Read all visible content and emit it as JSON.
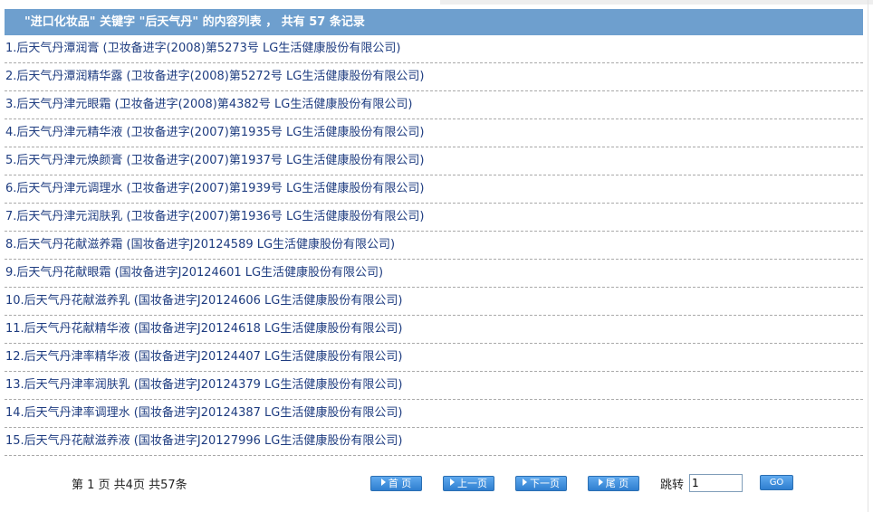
{
  "header": {
    "prefix": "\"进口化妆品\" 关键字 \"后天气丹\" 的内容列表 ， 共有 ",
    "count": "57",
    "suffix": " 条记录"
  },
  "items": [
    "1.后天气丹潭润膏 (卫妆备进字(2008)第5273号 LG生活健康股份有限公司)",
    "2.后天气丹潭润精华露 (卫妆备进字(2008)第5272号 LG生活健康股份有限公司)",
    "3.后天气丹津元眼霜 (卫妆备进字(2008)第4382号 LG生活健康股份有限公司)",
    "4.后天气丹津元精华液 (卫妆备进字(2007)第1935号 LG生活健康股份有限公司)",
    "5.后天气丹津元焕颜膏 (卫妆备进字(2007)第1937号 LG生活健康股份有限公司)",
    "6.后天气丹津元调理水 (卫妆备进字(2007)第1939号 LG生活健康股份有限公司)",
    "7.后天气丹津元润肤乳 (卫妆备进字(2007)第1936号 LG生活健康股份有限公司)",
    "8.后天气丹花献滋养霜 (国妆备进字J20124589 LG生活健康股份有限公司)",
    "9.后天气丹花献眼霜 (国妆备进字J20124601 LG生活健康股份有限公司)",
    "10.后天气丹花献滋养乳 (国妆备进字J20124606 LG生活健康股份有限公司)",
    "11.后天气丹花献精华液 (国妆备进字J20124618 LG生活健康股份有限公司)",
    "12.后天气丹津率精华液 (国妆备进字J20124407 LG生活健康股份有限公司)",
    "13.后天气丹津率润肤乳 (国妆备进字J20124379 LG生活健康股份有限公司)",
    "14.后天气丹津率调理水 (国妆备进字J20124387 LG生活健康股份有限公司)",
    "15.后天气丹花献滋养液 (国妆备进字J20127996 LG生活健康股份有限公司)"
  ],
  "pager": {
    "info": "第 1 页 共4页 共57条",
    "first": "首 页",
    "prev": "上一页",
    "next": "下一页",
    "last": "尾 页",
    "jump_label": "跳转",
    "jump_value": "1",
    "go": "GO"
  },
  "icons": {
    "nav_arrow": "triangle-right-icon"
  },
  "colors": {
    "header_bg": "#6e9fce",
    "link": "#1e3c80",
    "button": "#3d8fdf"
  }
}
